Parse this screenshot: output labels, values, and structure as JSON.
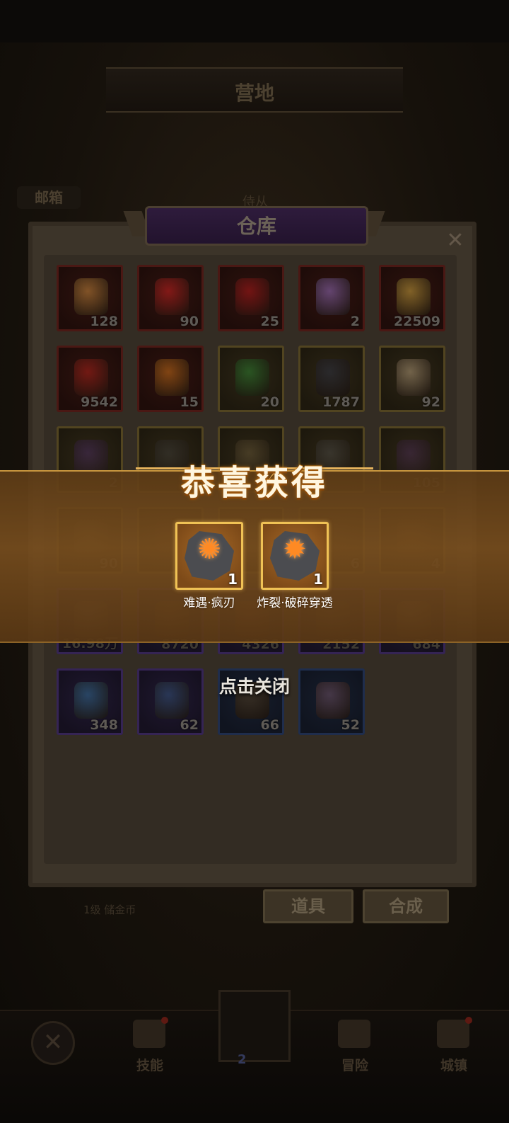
{
  "background": {
    "screen_title": "营地",
    "mailbox_label": "邮箱",
    "tab_hint": "侍从",
    "gold_label": "1级 储金币"
  },
  "warehouse": {
    "title": "仓库",
    "close_symbol": "✕",
    "items": [
      {
        "icon": "feather-icon",
        "count": "128",
        "color": "#8a5a2a",
        "rarity": "red"
      },
      {
        "icon": "red-heart-gem-icon",
        "count": "90",
        "color": "#8c1a18",
        "rarity": "red"
      },
      {
        "icon": "red-crystal-icon",
        "count": "25",
        "color": "#7a1414",
        "rarity": "red"
      },
      {
        "icon": "rainbow-crystal-icon",
        "count": "2",
        "color": "#6a4a7a",
        "rarity": "red"
      },
      {
        "icon": "gold-crystal-icon",
        "count": "22509",
        "color": "#8a6a2a",
        "rarity": "red"
      },
      {
        "icon": "red-ore-icon",
        "count": "9542",
        "color": "#7a1a14",
        "rarity": "red"
      },
      {
        "icon": "gold-heart-icon",
        "count": "15",
        "color": "#8a4a14",
        "rarity": "red"
      },
      {
        "icon": "green-potion-icon",
        "count": "20",
        "color": "#2a5a24",
        "rarity": "gold"
      },
      {
        "icon": "dark-ore-icon",
        "count": "1787",
        "color": "#2a2a2e",
        "rarity": "gold"
      },
      {
        "icon": "candle-icon",
        "count": "92",
        "color": "#7a6a50",
        "rarity": "gold"
      },
      {
        "icon": "purple-flame-icon",
        "count": "2",
        "color": "#4a2a6a",
        "rarity": "gold"
      },
      {
        "icon": "stone-pile-icon",
        "count": "",
        "color": "#3a3a3a",
        "rarity": "gold"
      },
      {
        "icon": "scroll-icon",
        "count": "",
        "color": "#6a5a3a",
        "rarity": "gold"
      },
      {
        "icon": "crossed-blades-icon",
        "count": "",
        "color": "#4a4a4a",
        "rarity": "gold"
      },
      {
        "icon": "purple-potion-icon",
        "count": "105",
        "color": "#4a2a5a",
        "rarity": "gold"
      },
      {
        "icon": "map-scroll-icon",
        "count": "90",
        "color": "#5a4a2a",
        "rarity": "gold"
      },
      {
        "icon": "item-icon",
        "count": "",
        "color": "#4a2a1a",
        "rarity": "gold"
      },
      {
        "icon": "item-icon",
        "count": "",
        "color": "#4a3a2a",
        "rarity": "gold"
      },
      {
        "icon": "item-icon",
        "count": "6",
        "color": "#3a2a1a",
        "rarity": "gold"
      },
      {
        "icon": "heart-relic-icon",
        "count": "4",
        "color": "#5a3a1a",
        "rarity": "gold"
      },
      {
        "icon": "eye-rune-icon",
        "count": "16.98万",
        "color": "#5a5048",
        "rarity": "purple"
      },
      {
        "icon": "ore-icon",
        "count": "8720",
        "color": "#5a3a1a",
        "rarity": "purple"
      },
      {
        "icon": "red-shard-icon",
        "count": "4326",
        "color": "#6a2a1a",
        "rarity": "purple"
      },
      {
        "icon": "quill-icon",
        "count": "2152",
        "color": "#4a3a2a",
        "rarity": "purple"
      },
      {
        "icon": "sun-scroll-icon",
        "count": "684",
        "color": "#6a5a3a",
        "rarity": "purple"
      },
      {
        "icon": "blue-potion-icon",
        "count": "348",
        "color": "#2a4a6a",
        "rarity": "purple"
      },
      {
        "icon": "blue-crystal-icon",
        "count": "62",
        "color": "#2a3a5a",
        "rarity": "purple"
      },
      {
        "icon": "coal-ore-icon",
        "count": "66",
        "color": "#3a3024",
        "rarity": "blue"
      },
      {
        "icon": "purple-sand-icon",
        "count": "52",
        "color": "#4a3a4a",
        "rarity": "blue"
      }
    ]
  },
  "reward": {
    "title": "恭喜获得",
    "items": [
      {
        "icon": "vortex-rune-icon",
        "glyph": "✺",
        "qty": "1",
        "name": "难遇·疯刃"
      },
      {
        "icon": "burst-rune-icon",
        "glyph": "✹",
        "qty": "1",
        "name": "炸裂·破碎穿透"
      }
    ],
    "tap_to_close": "点击关闭"
  },
  "buttons": {
    "props_label": "道具",
    "synth_label": "合成"
  },
  "bottom_nav": {
    "close_symbol": "✕",
    "skills_label": "技能",
    "center_count": "2",
    "adventure_label": "冒险",
    "city_label": "城镇"
  }
}
